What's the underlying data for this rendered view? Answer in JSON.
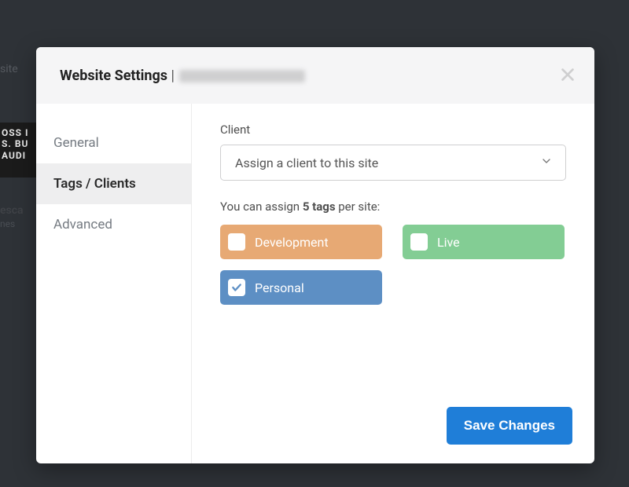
{
  "backdrop": {
    "site_fragment": "site",
    "card_lines": "OSS I\nS. BU\nAUDI",
    "esc_label": "esca",
    "esc_sub": "nes"
  },
  "modal": {
    "title_prefix": "Website Settings",
    "title_separator": " | "
  },
  "sidebar": {
    "items": [
      {
        "id": "general",
        "label": "General",
        "active": false
      },
      {
        "id": "tags-clients",
        "label": "Tags / Clients",
        "active": true
      },
      {
        "id": "advanced",
        "label": "Advanced",
        "active": false
      }
    ]
  },
  "content": {
    "client_label": "Client",
    "client_placeholder": "Assign a client to this site",
    "tags_note_pre": "You can assign ",
    "tags_note_bold": "5 tags",
    "tags_note_post": " per site:",
    "tags": [
      {
        "id": "development",
        "label": "Development",
        "color": "dev",
        "checked": false
      },
      {
        "id": "live",
        "label": "Live",
        "color": "live",
        "checked": false
      },
      {
        "id": "personal",
        "label": "Personal",
        "color": "personal",
        "checked": true
      }
    ]
  },
  "footer": {
    "save_label": "Save Changes"
  }
}
